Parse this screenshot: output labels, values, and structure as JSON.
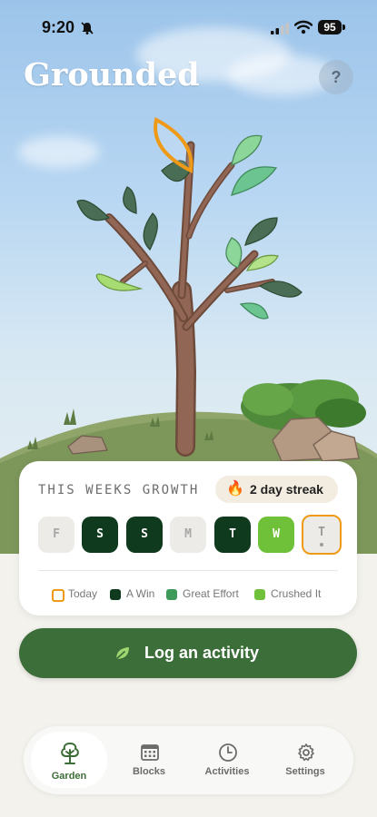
{
  "status": {
    "time": "9:20",
    "battery": "95"
  },
  "app": {
    "title": "Grounded",
    "help_label": "?"
  },
  "growth": {
    "title": "THIS WEEKS GROWTH",
    "streak_label": "2 day streak",
    "days": [
      {
        "letter": "F",
        "state": "none"
      },
      {
        "letter": "S",
        "state": "win"
      },
      {
        "letter": "S",
        "state": "win"
      },
      {
        "letter": "M",
        "state": "none"
      },
      {
        "letter": "T",
        "state": "win"
      },
      {
        "letter": "W",
        "state": "crushed"
      },
      {
        "letter": "T",
        "state": "today"
      }
    ],
    "legend": {
      "today": "Today",
      "win": "A Win",
      "great_effort": "Great Effort",
      "crushed": "Crushed It"
    }
  },
  "cta": {
    "label": "Log an activity"
  },
  "tabs": [
    {
      "label": "Garden",
      "icon": "tree-icon",
      "active": true
    },
    {
      "label": "Blocks",
      "icon": "calendar-grid-icon",
      "active": false
    },
    {
      "label": "Activities",
      "icon": "clock-icon",
      "active": false
    },
    {
      "label": "Settings",
      "icon": "gear-icon",
      "active": false
    }
  ],
  "colors": {
    "win": "#0f3a1e",
    "great_effort": "#3d9a5a",
    "crushed": "#6fc13a",
    "today_outline": "#ef9a17",
    "primary": "#3c6e3a"
  }
}
